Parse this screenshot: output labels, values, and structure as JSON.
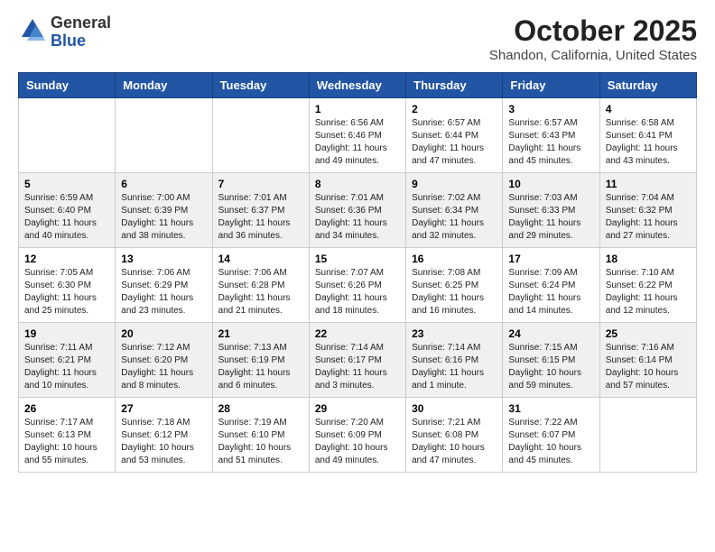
{
  "logo": {
    "general": "General",
    "blue": "Blue"
  },
  "header": {
    "month": "October 2025",
    "location": "Shandon, California, United States"
  },
  "days_of_week": [
    "Sunday",
    "Monday",
    "Tuesday",
    "Wednesday",
    "Thursday",
    "Friday",
    "Saturday"
  ],
  "weeks": [
    [
      {
        "day": "",
        "info": ""
      },
      {
        "day": "",
        "info": ""
      },
      {
        "day": "",
        "info": ""
      },
      {
        "day": "1",
        "info": "Sunrise: 6:56 AM\nSunset: 6:46 PM\nDaylight: 11 hours and 49 minutes."
      },
      {
        "day": "2",
        "info": "Sunrise: 6:57 AM\nSunset: 6:44 PM\nDaylight: 11 hours and 47 minutes."
      },
      {
        "day": "3",
        "info": "Sunrise: 6:57 AM\nSunset: 6:43 PM\nDaylight: 11 hours and 45 minutes."
      },
      {
        "day": "4",
        "info": "Sunrise: 6:58 AM\nSunset: 6:41 PM\nDaylight: 11 hours and 43 minutes."
      }
    ],
    [
      {
        "day": "5",
        "info": "Sunrise: 6:59 AM\nSunset: 6:40 PM\nDaylight: 11 hours and 40 minutes."
      },
      {
        "day": "6",
        "info": "Sunrise: 7:00 AM\nSunset: 6:39 PM\nDaylight: 11 hours and 38 minutes."
      },
      {
        "day": "7",
        "info": "Sunrise: 7:01 AM\nSunset: 6:37 PM\nDaylight: 11 hours and 36 minutes."
      },
      {
        "day": "8",
        "info": "Sunrise: 7:01 AM\nSunset: 6:36 PM\nDaylight: 11 hours and 34 minutes."
      },
      {
        "day": "9",
        "info": "Sunrise: 7:02 AM\nSunset: 6:34 PM\nDaylight: 11 hours and 32 minutes."
      },
      {
        "day": "10",
        "info": "Sunrise: 7:03 AM\nSunset: 6:33 PM\nDaylight: 11 hours and 29 minutes."
      },
      {
        "day": "11",
        "info": "Sunrise: 7:04 AM\nSunset: 6:32 PM\nDaylight: 11 hours and 27 minutes."
      }
    ],
    [
      {
        "day": "12",
        "info": "Sunrise: 7:05 AM\nSunset: 6:30 PM\nDaylight: 11 hours and 25 minutes."
      },
      {
        "day": "13",
        "info": "Sunrise: 7:06 AM\nSunset: 6:29 PM\nDaylight: 11 hours and 23 minutes."
      },
      {
        "day": "14",
        "info": "Sunrise: 7:06 AM\nSunset: 6:28 PM\nDaylight: 11 hours and 21 minutes."
      },
      {
        "day": "15",
        "info": "Sunrise: 7:07 AM\nSunset: 6:26 PM\nDaylight: 11 hours and 18 minutes."
      },
      {
        "day": "16",
        "info": "Sunrise: 7:08 AM\nSunset: 6:25 PM\nDaylight: 11 hours and 16 minutes."
      },
      {
        "day": "17",
        "info": "Sunrise: 7:09 AM\nSunset: 6:24 PM\nDaylight: 11 hours and 14 minutes."
      },
      {
        "day": "18",
        "info": "Sunrise: 7:10 AM\nSunset: 6:22 PM\nDaylight: 11 hours and 12 minutes."
      }
    ],
    [
      {
        "day": "19",
        "info": "Sunrise: 7:11 AM\nSunset: 6:21 PM\nDaylight: 11 hours and 10 minutes."
      },
      {
        "day": "20",
        "info": "Sunrise: 7:12 AM\nSunset: 6:20 PM\nDaylight: 11 hours and 8 minutes."
      },
      {
        "day": "21",
        "info": "Sunrise: 7:13 AM\nSunset: 6:19 PM\nDaylight: 11 hours and 6 minutes."
      },
      {
        "day": "22",
        "info": "Sunrise: 7:14 AM\nSunset: 6:17 PM\nDaylight: 11 hours and 3 minutes."
      },
      {
        "day": "23",
        "info": "Sunrise: 7:14 AM\nSunset: 6:16 PM\nDaylight: 11 hours and 1 minute."
      },
      {
        "day": "24",
        "info": "Sunrise: 7:15 AM\nSunset: 6:15 PM\nDaylight: 10 hours and 59 minutes."
      },
      {
        "day": "25",
        "info": "Sunrise: 7:16 AM\nSunset: 6:14 PM\nDaylight: 10 hours and 57 minutes."
      }
    ],
    [
      {
        "day": "26",
        "info": "Sunrise: 7:17 AM\nSunset: 6:13 PM\nDaylight: 10 hours and 55 minutes."
      },
      {
        "day": "27",
        "info": "Sunrise: 7:18 AM\nSunset: 6:12 PM\nDaylight: 10 hours and 53 minutes."
      },
      {
        "day": "28",
        "info": "Sunrise: 7:19 AM\nSunset: 6:10 PM\nDaylight: 10 hours and 51 minutes."
      },
      {
        "day": "29",
        "info": "Sunrise: 7:20 AM\nSunset: 6:09 PM\nDaylight: 10 hours and 49 minutes."
      },
      {
        "day": "30",
        "info": "Sunrise: 7:21 AM\nSunset: 6:08 PM\nDaylight: 10 hours and 47 minutes."
      },
      {
        "day": "31",
        "info": "Sunrise: 7:22 AM\nSunset: 6:07 PM\nDaylight: 10 hours and 45 minutes."
      },
      {
        "day": "",
        "info": ""
      }
    ]
  ]
}
